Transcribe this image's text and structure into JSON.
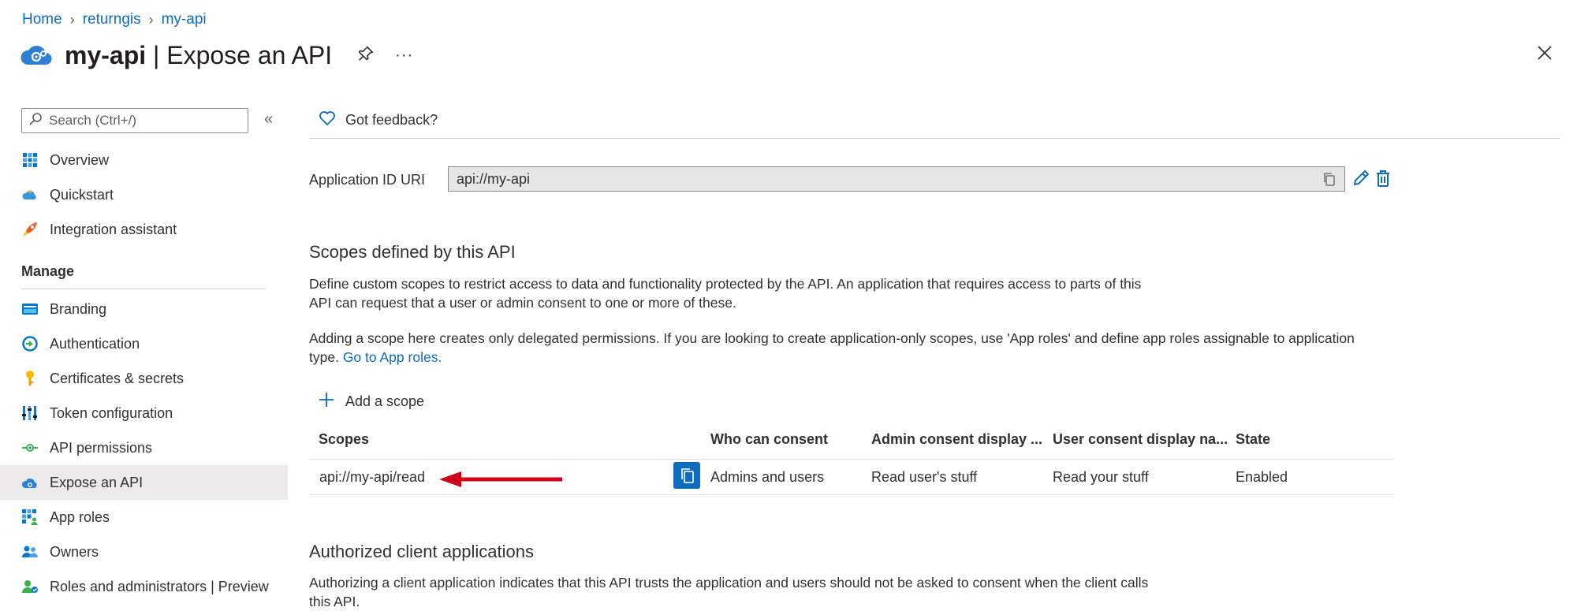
{
  "breadcrumb": {
    "home": "Home",
    "tenant": "returngis",
    "app": "my-api"
  },
  "header": {
    "app_name": "my-api",
    "separator": " | ",
    "page": "Expose an API",
    "more": "···"
  },
  "sidebar": {
    "search_placeholder": "Search (Ctrl+/)",
    "collapse": "«",
    "items_top": [
      {
        "label": "Overview",
        "icon": "overview-grid-icon"
      },
      {
        "label": "Quickstart",
        "icon": "quickstart-cloud-icon"
      },
      {
        "label": "Integration assistant",
        "icon": "rocket-icon"
      }
    ],
    "manage_heading": "Manage",
    "items_manage": [
      {
        "label": "Branding",
        "icon": "branding-card-icon"
      },
      {
        "label": "Authentication",
        "icon": "authentication-icon"
      },
      {
        "label": "Certificates & secrets",
        "icon": "key-icon"
      },
      {
        "label": "Token configuration",
        "icon": "token-bars-icon"
      },
      {
        "label": "API permissions",
        "icon": "api-permissions-icon"
      },
      {
        "label": "Expose an API",
        "icon": "expose-api-cloud-icon",
        "active": true
      },
      {
        "label": "App roles",
        "icon": "app-roles-icon"
      },
      {
        "label": "Owners",
        "icon": "owners-icon"
      },
      {
        "label": "Roles and administrators | Preview",
        "icon": "roles-admins-icon"
      }
    ]
  },
  "toolbar": {
    "feedback": "Got feedback?"
  },
  "app_id": {
    "label": "Application ID URI",
    "value": "api://my-api"
  },
  "scopes_section": {
    "title": "Scopes defined by this API",
    "desc_line1": "Define custom scopes to restrict access to data and functionality protected by the API. An application that requires access to parts of this",
    "desc_line2": "API can request that a user or admin consent to one or more of these.",
    "note_line1": "Adding a scope here creates only delegated permissions. If you are looking to create application-only scopes, use 'App roles' and define app roles assignable to application",
    "note_line2_prefix": "type. ",
    "note_link": "Go to App roles.",
    "add_scope": "Add a scope",
    "columns": [
      "Scopes",
      "Who can consent",
      "Admin consent display ...",
      "User consent display na...",
      "State"
    ],
    "rows": [
      {
        "scope": "api://my-api/read",
        "who": "Admins and users",
        "admin_display": "Read user's stuff",
        "user_display": "Read your stuff",
        "state": "Enabled"
      }
    ]
  },
  "authorized_section": {
    "title": "Authorized client applications",
    "desc_line1": "Authorizing a client application indicates that this API trusts the application and users should not be asked to consent when the client calls",
    "desc_line2": "this API."
  },
  "colors": {
    "accent": "#0f6cbd",
    "annotation_arrow": "#d0021b"
  }
}
